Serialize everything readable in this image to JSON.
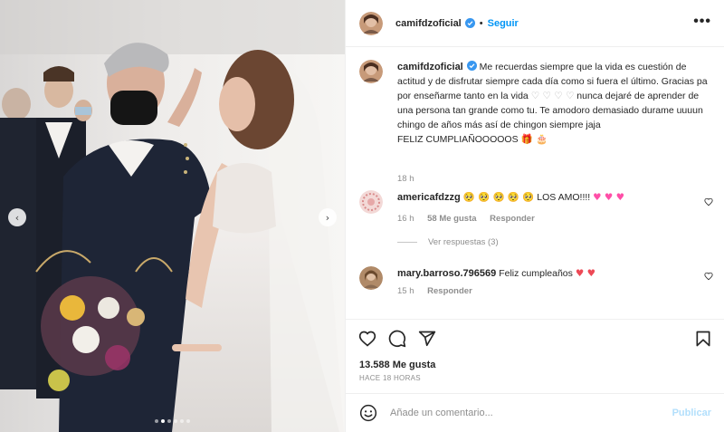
{
  "post": {
    "username": "camifdzoficial",
    "follow_label": "Seguir",
    "separator": "•",
    "more_label": "•••",
    "caption_lines": [
      "Me recuerdas siempre que la vida es cuestión de actitud y de disfrutar siempre cada día como si fuera el último. Gracias pa por enseñarme tanto en la vida",
      "nunca dejaré de aprender de una persona tan grande como tu. Te amodoro demasiado durame uuuun chingo de años más así de chingon siempre jaja",
      "FELIZ CUMPLIAÑOOOOOS"
    ],
    "caption_hearts": "♡ ♡ ♡ ♡",
    "caption_emojis": "🎁 🎂",
    "caption_time": "18 h",
    "likes": "13.588 Me gusta",
    "posted_ago": "HACE 18 HORAS"
  },
  "comments": [
    {
      "username": "americafdzzg",
      "emojis": "🥺 🥺 🥺 🥺 🥺",
      "text": "LOS AMO!!!!",
      "hearts": "♥ ♥ ♥",
      "time": "16 h",
      "likes": "58 Me gusta",
      "reply_label": "Responder",
      "view_replies": "Ver respuestas (3)"
    },
    {
      "username": "mary.barroso.796569",
      "text": "Feliz cumpleaños",
      "hearts": "♥ ♥",
      "time": "15 h",
      "reply_label": "Responder"
    }
  ],
  "media": {
    "prev_label": "‹",
    "next_label": "›",
    "dot_count": 6
  },
  "comment_box": {
    "placeholder": "Añade un comentario...",
    "publish_label": "Publicar"
  },
  "icons": [
    "heart-icon",
    "comment-icon",
    "share-icon",
    "bookmark-icon",
    "emoji-icon",
    "verified-icon",
    "more-icon"
  ],
  "colors": {
    "accent": "#0095f6",
    "muted": "#8e8e8e",
    "publish_disabled": "#b2dffc",
    "like_red": "#ed4956"
  }
}
